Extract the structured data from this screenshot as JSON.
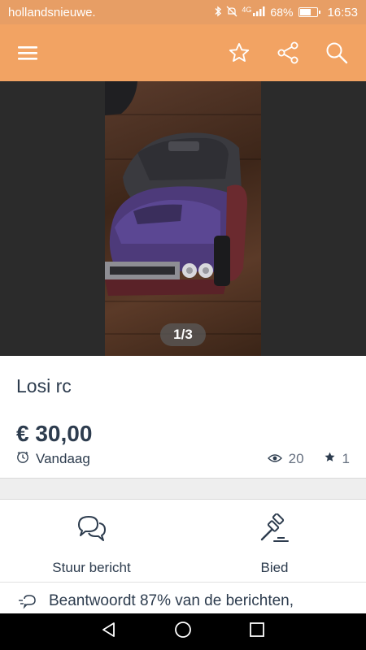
{
  "status_bar": {
    "carrier": "hollandsnieuwe.",
    "network": "4G",
    "battery": "68%",
    "battery_level": 0.68,
    "time": "16:53"
  },
  "app_bar": {
    "icons": [
      "menu-icon",
      "star-icon",
      "share-icon",
      "search-icon"
    ]
  },
  "gallery": {
    "counter": "1/3"
  },
  "listing": {
    "title": "Losi rc",
    "price": "€ 30,00",
    "date": "Vandaag",
    "views": "20",
    "favorites": "1"
  },
  "actions": {
    "message_label": "Stuur bericht",
    "bid_label": "Bied"
  },
  "seller_info": {
    "response_text": "Beantwoordt 87% van de berichten,"
  },
  "colors": {
    "app_bar": "#f2a363",
    "status_bar": "#e79e65",
    "text": "#2d3c4e"
  }
}
